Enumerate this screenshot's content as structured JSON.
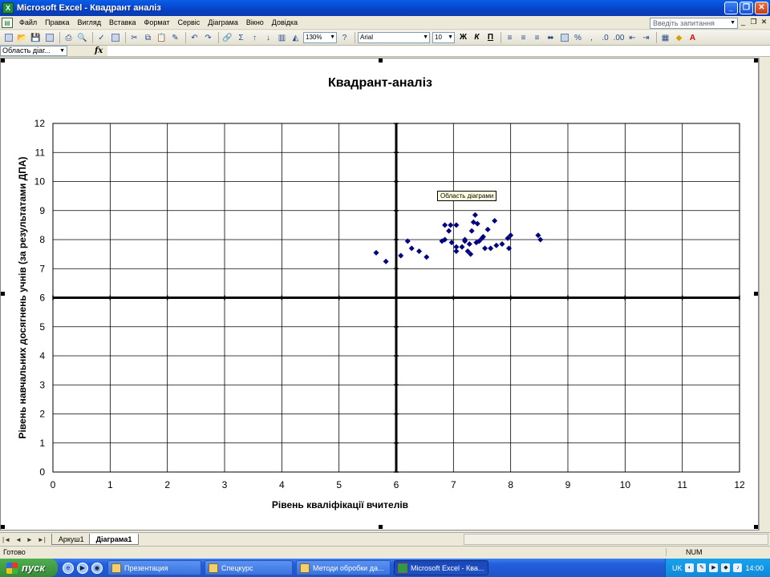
{
  "window": {
    "title": "Microsoft Excel - Квадрант аналіз",
    "icon_label": "X"
  },
  "menu": {
    "items": [
      "Файл",
      "Правка",
      "Вигляд",
      "Вставка",
      "Формат",
      "Сервіс",
      "Діаграма",
      "Вікно",
      "Довідка"
    ],
    "help_placeholder": "Введіть запитання"
  },
  "toolbar": {
    "zoom": "130%",
    "font": "Arial",
    "size": "10",
    "bold": "Ж",
    "italic": "К",
    "underline": "П"
  },
  "formula": {
    "namebox": "Область діаг...",
    "fx": "fx"
  },
  "tooltip": "Область діаграми",
  "sheet_tabs": [
    "Аркуш1",
    "Діаграма1"
  ],
  "status": {
    "ready": "Готово",
    "num": "NUM"
  },
  "taskbar": {
    "start": "пуск",
    "tasks": [
      "Презентация",
      "Спецкурс",
      "Методи обробки да...",
      "Microsoft Excel - Ква..."
    ],
    "lang": "UK",
    "clock": "14:00"
  },
  "chart_data": {
    "type": "scatter",
    "title": "Квадрант-аналіз",
    "xlabel": "Рівень кваліфікації вчителів",
    "ylabel": "Рівень навчальних досягнень учнів (за результатами ДПА)",
    "xlim": [
      0,
      12
    ],
    "ylim": [
      0,
      12
    ],
    "xticks": [
      0,
      1,
      2,
      3,
      4,
      5,
      6,
      7,
      8,
      9,
      10,
      11,
      12
    ],
    "yticks": [
      0,
      1,
      2,
      3,
      4,
      5,
      6,
      7,
      8,
      9,
      10,
      11,
      12
    ],
    "grid": true,
    "quadrant_lines": {
      "x": 6,
      "y": 6
    },
    "color": "#000080",
    "points": [
      [
        5.65,
        7.55
      ],
      [
        5.82,
        7.25
      ],
      [
        6.08,
        7.45
      ],
      [
        6.2,
        7.95
      ],
      [
        6.27,
        7.7
      ],
      [
        6.4,
        7.6
      ],
      [
        6.53,
        7.4
      ],
      [
        6.8,
        7.95
      ],
      [
        6.85,
        8.0
      ],
      [
        6.85,
        8.5
      ],
      [
        6.92,
        8.3
      ],
      [
        6.95,
        8.5
      ],
      [
        6.97,
        7.9
      ],
      [
        7.05,
        8.5
      ],
      [
        7.05,
        7.75
      ],
      [
        7.05,
        7.6
      ],
      [
        7.15,
        7.75
      ],
      [
        7.2,
        7.95
      ],
      [
        7.2,
        8.0
      ],
      [
        7.25,
        7.6
      ],
      [
        7.28,
        7.85
      ],
      [
        7.3,
        7.5
      ],
      [
        7.32,
        8.3
      ],
      [
        7.35,
        8.6
      ],
      [
        7.38,
        8.85
      ],
      [
        7.4,
        7.9
      ],
      [
        7.42,
        8.55
      ],
      [
        7.45,
        7.95
      ],
      [
        7.5,
        8.05
      ],
      [
        7.52,
        8.1
      ],
      [
        7.55,
        7.7
      ],
      [
        7.6,
        8.35
      ],
      [
        7.65,
        7.7
      ],
      [
        7.72,
        8.65
      ],
      [
        7.75,
        7.8
      ],
      [
        7.85,
        7.85
      ],
      [
        7.95,
        8.05
      ],
      [
        7.97,
        7.7
      ],
      [
        8.0,
        8.15
      ],
      [
        8.48,
        8.15
      ],
      [
        8.52,
        8.0
      ]
    ]
  }
}
